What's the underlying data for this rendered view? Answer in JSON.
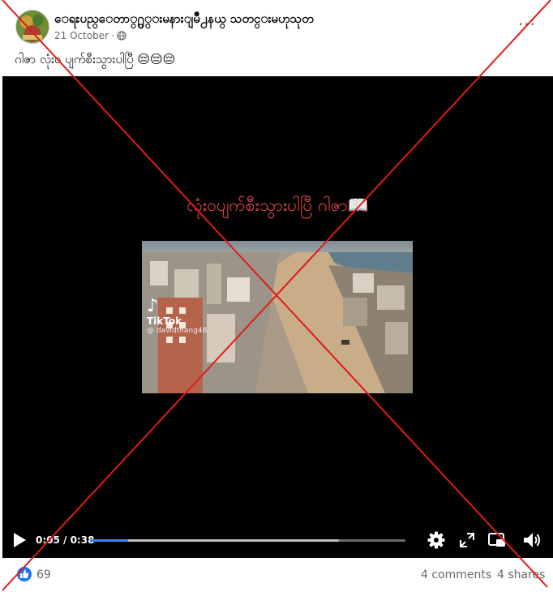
{
  "post": {
    "author": "ေရႊပည္ေတာ္႐ွ္းမနားျမိဳ႕နယ္ သတင္းမဟုသုတ",
    "date": "21 October",
    "separator": "·",
    "audience_icon": "globe-icon",
    "more_icon": "more-options-icon",
    "more_label": "···",
    "caption": "ဂါဇာ လုံးဝ ပျက်စီးသွားပါပြီ 😔😔😔"
  },
  "video": {
    "overlay_text": "လုံးဝပျက်စီးသွားပါပြီ ဂါဇာ📖",
    "watermark": {
      "logo_glyph": "♪",
      "brand": "TikTok",
      "handle": "@ davidthang48"
    },
    "controls": {
      "time": "0:05 / 0:38",
      "progress_played": 0.12,
      "progress_buffered": 0.79,
      "icons": [
        "play-icon",
        "settings-icon",
        "fullscreen-icon",
        "picture-in-picture-icon",
        "volume-icon"
      ]
    }
  },
  "footer": {
    "like_count": "69",
    "comments": "4 comments",
    "shares": "4 shares"
  },
  "colors": {
    "accent": "#1877f2",
    "progress": "#2d88ff",
    "overlay_text": "#e84c4c",
    "cross": "#e01a1a"
  }
}
